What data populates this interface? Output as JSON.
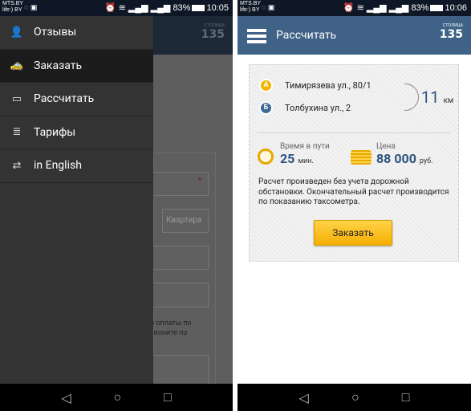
{
  "status_left": {
    "carrier1": "MTS.BY",
    "carrier2": "life:) BY",
    "battery": "83%",
    "time": "10:05"
  },
  "status_right": {
    "carrier1": "MTS.BY",
    "carrier2": "life:) BY",
    "battery": "83%",
    "time": "10:06"
  },
  "logo": {
    "small": "СТОЛИЦА",
    "number": "135"
  },
  "drawer": {
    "items": [
      {
        "label": "Отзывы",
        "icon": "person-icon",
        "selected": false
      },
      {
        "label": "Заказать",
        "icon": "taxi-car-icon",
        "selected": true
      },
      {
        "label": "Рассчитать",
        "icon": "wallet-icon",
        "selected": false
      },
      {
        "label": "Тарифы",
        "icon": "coins-icon",
        "selected": false
      },
      {
        "label": "in English",
        "icon": "refresh-icon",
        "selected": false
      }
    ]
  },
  "background_form": {
    "apartment_placeholder": "Квартира",
    "text_line1": "и оплаты по",
    "text_line2": "звоните по"
  },
  "calc": {
    "title": "Рассчитать",
    "from_marker": "А",
    "from": "Тимирязева ул., 80/1",
    "to_marker": "Б",
    "to": "Толбухина ул., 2",
    "distance": "11",
    "distance_unit": "км",
    "time_label": "Время в пути",
    "time_value": "25",
    "time_unit": "мин.",
    "price_label": "Цена",
    "price_value": "88 000",
    "price_unit": "руб.",
    "note": "Расчет произведен без учета дорожной обстановки. Окончательный расчет производится по показанию таксометра.",
    "order_button": "Заказать"
  },
  "colors": {
    "header": "#3f6286",
    "accent_value": "#2d5480",
    "button": "#f5b800",
    "pin_a": "#f2b400",
    "pin_b": "#3f6a96"
  }
}
